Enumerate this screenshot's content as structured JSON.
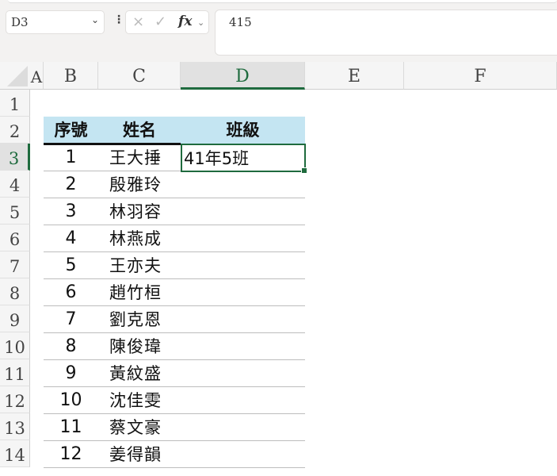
{
  "formula_bar": {
    "name_box": "D3",
    "formula": "415",
    "cancel_icon": "×",
    "enter_icon": "✓",
    "fx_label": "fx"
  },
  "columns": [
    "A",
    "B",
    "C",
    "D",
    "E",
    "F"
  ],
  "rows": [
    "1",
    "2",
    "3",
    "4",
    "5",
    "6",
    "7",
    "8",
    "9",
    "10",
    "11",
    "12",
    "13",
    "14"
  ],
  "table": {
    "headers": [
      "序號",
      "姓名",
      "班級"
    ],
    "records": [
      {
        "no": "1",
        "name": "王大捶"
      },
      {
        "no": "2",
        "name": "殷雅玲"
      },
      {
        "no": "3",
        "name": "林羽容"
      },
      {
        "no": "4",
        "name": "林燕成"
      },
      {
        "no": "5",
        "name": "王亦夫"
      },
      {
        "no": "6",
        "name": "趙竹桓"
      },
      {
        "no": "7",
        "name": "劉克恩"
      },
      {
        "no": "8",
        "name": "陳俊瑋"
      },
      {
        "no": "9",
        "name": "黃紋盛"
      },
      {
        "no": "10",
        "name": "沈佳雯"
      },
      {
        "no": "11",
        "name": "蔡文豪"
      },
      {
        "no": "12",
        "name": "姜得韻"
      }
    ],
    "active_cell_value": "41年5班"
  },
  "colors": {
    "header_fill": "#c4e5f2",
    "selection": "#1f6b3e"
  }
}
